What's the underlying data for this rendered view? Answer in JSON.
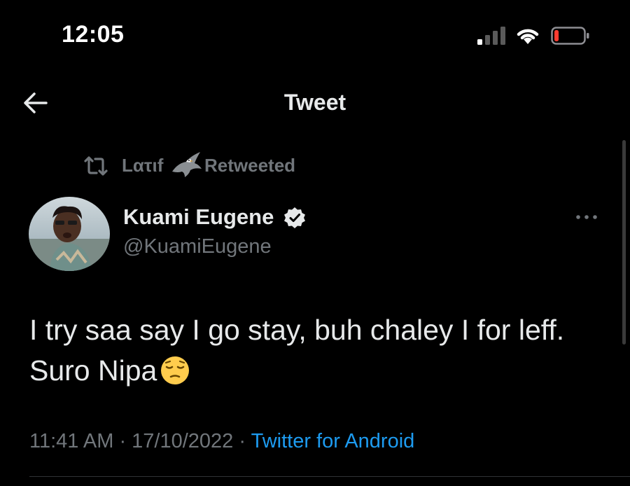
{
  "status_bar": {
    "time": "12:05",
    "icons": [
      "cellular-signal-icon",
      "wifi-icon",
      "battery-icon"
    ]
  },
  "header": {
    "back_icon": "arrow-left-icon",
    "title": "Tweet"
  },
  "retweet": {
    "icon": "retweet-icon",
    "name": "Lατιf",
    "name_emoji": "eagle-icon",
    "label": "Retweeted"
  },
  "tweet": {
    "author": {
      "display_name": "Kuami Eugene",
      "verified": true,
      "handle": "@KuamiEugene"
    },
    "text": "I try saa say I go stay, buh chaley I for leff. Suro Nipa",
    "text_emoji": "pensive-face-icon",
    "time": "11:41 AM",
    "date": "17/10/2022",
    "separator": " · ",
    "source": "Twitter for Android",
    "more_icon": "more-horizontal-icon"
  },
  "colors": {
    "background": "#000000",
    "primary_text": "#e7e9ea",
    "secondary_text": "#71767b",
    "link": "#1d9bf0",
    "battery_low": "#ff3b30"
  }
}
